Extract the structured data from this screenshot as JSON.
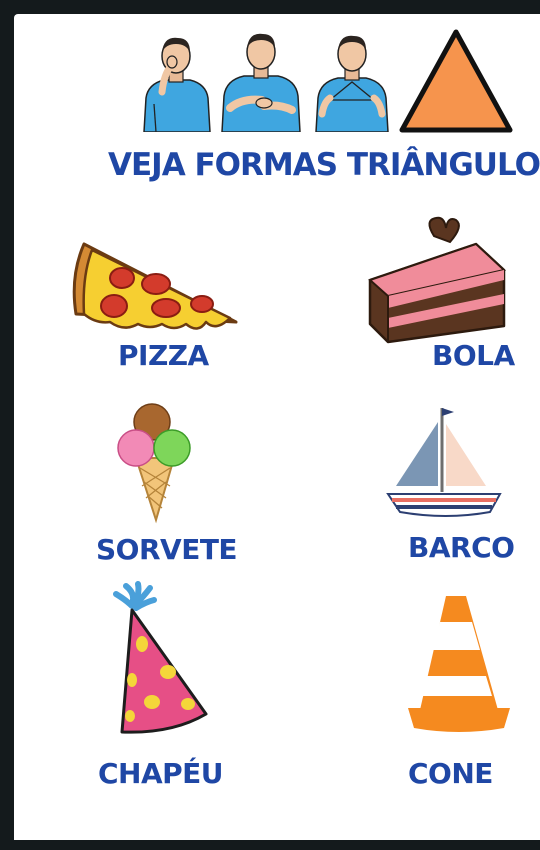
{
  "title": "VEJA FORMAS TRIÂNGULO",
  "items": [
    {
      "label": "PIZZA"
    },
    {
      "label": "BOLA"
    },
    {
      "label": "SORVETE"
    },
    {
      "label": "BARCO"
    },
    {
      "label": "CHAPÉU"
    },
    {
      "label": "CONE"
    }
  ],
  "colors": {
    "label_blue": "#1f47a5",
    "shirt_blue": "#3fa6e0",
    "triangle_orange": "#f6944d"
  }
}
